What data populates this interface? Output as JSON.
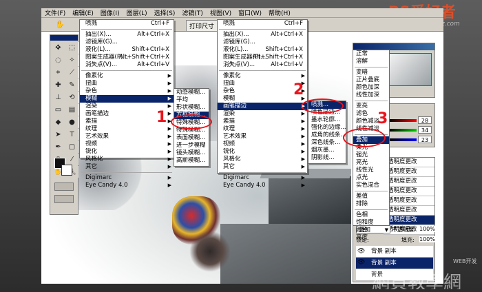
{
  "watermark": {
    "logo": "PS爱好者",
    "url": "www.psahz.com"
  },
  "watermark_bottom": {
    "text": "網頁教學網",
    "sub": "WEB开发"
  },
  "menubar": [
    "文件(F)",
    "编辑(E)",
    "图像(I)",
    "图层(L)",
    "选择(S)",
    "滤镜(T)",
    "视图(V)",
    "窗口(W)",
    "帮助(H)"
  ],
  "optbar": {
    "button": "打印尺寸"
  },
  "menu1": {
    "top": [
      {
        "label": "喷溅",
        "shortcut": "Ctrl+F"
      },
      {
        "label": "抽出(X)...",
        "shortcut": "Alt+Ctrl+X"
      },
      {
        "label": "滤镜库(G)...",
        "shortcut": ""
      },
      {
        "label": "液化(L)...",
        "shortcut": "Shift+Ctrl+X"
      },
      {
        "label": "图案生成器(P)...",
        "shortcut": "Alt+Shift+Ctrl+X"
      },
      {
        "label": "消失点(V)...",
        "shortcut": "Alt+Ctrl+V"
      }
    ],
    "items": [
      "像素化",
      "扭曲",
      "杂色",
      "模糊",
      "渲染",
      "画笔描边",
      "素描",
      "纹理",
      "艺术效果",
      "视频",
      "锐化",
      "风格化",
      "其它"
    ],
    "bottom": [
      "Digimarc",
      "Eye Candy 4.0"
    ]
  },
  "blur_submenu": [
    "动感模糊...",
    "平均",
    "形状模糊...",
    "方框模糊...",
    "特殊模糊...",
    "特殊模糊...",
    "表面模糊...",
    "进一步模糊",
    "镜头模糊...",
    "高斯模糊..."
  ],
  "menu2": {
    "top": [
      {
        "label": "喷溅",
        "shortcut": "Ctrl+F"
      },
      {
        "label": "抽出(X)...",
        "shortcut": "Alt+Ctrl+X"
      },
      {
        "label": "滤镜库(G)...",
        "shortcut": ""
      },
      {
        "label": "液化(L)...",
        "shortcut": "Shift+Ctrl+X"
      },
      {
        "label": "图案生成器(P)...",
        "shortcut": "Alt+Shift+Ctrl+X"
      },
      {
        "label": "消失点(V)...",
        "shortcut": "Alt+Ctrl+V"
      }
    ],
    "items": [
      "像素化",
      "扭曲",
      "杂色",
      "模糊",
      "画笔描边",
      "渲染",
      "素描",
      "纹理",
      "艺术效果",
      "视频",
      "锐化",
      "风格化",
      "其它"
    ],
    "bottom": [
      "Digimarc",
      "Eye Candy 4.0"
    ]
  },
  "brush_submenu": [
    "喷溅...",
    "喷色描边...",
    "墨水轮廓...",
    "强化的边缘...",
    "成角的线条...",
    "深色线条...",
    "烟灰墨...",
    "阴影线..."
  ],
  "blend_modes": [
    "正常",
    "溶解",
    "变暗",
    "正片叠底",
    "颜色加深",
    "线性加深",
    "变亮",
    "滤色",
    "颜色减淡",
    "线性减淡",
    "叠加",
    "柔光",
    "强光",
    "亮光",
    "线性光",
    "点光",
    "实色混合",
    "差值",
    "排除",
    "色相",
    "饱和度",
    "颜色",
    "亮度"
  ],
  "color_panel": {
    "values": [
      "28",
      "34",
      "23"
    ]
  },
  "layers_panel": {
    "blend_mode": "叠加",
    "opacity_label": "不透明度:",
    "opacity": "100%",
    "lock_label": "锁定:",
    "fill_label": "填充:",
    "fill": "100%",
    "adjust_layers": [
      "透明度更改",
      "透明度更改",
      "透明度更改",
      "透明度更改",
      "透明度更改",
      "透明度更改",
      "透明度更改",
      "透明度更改"
    ],
    "layers": [
      "背景 副本",
      "背景 副本",
      "背景"
    ]
  },
  "annotations": {
    "one": "1",
    "two": "2",
    "three": "3"
  },
  "colors": {
    "highlight": "#0a246a",
    "annotation": "#e8141c"
  }
}
